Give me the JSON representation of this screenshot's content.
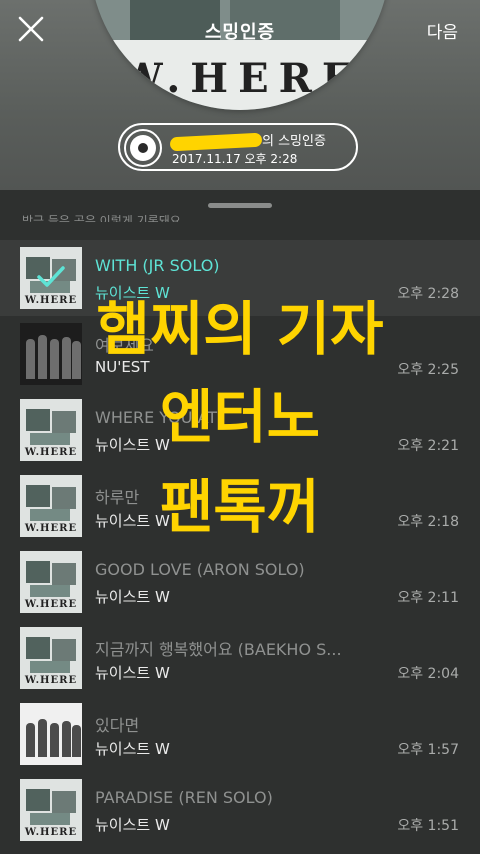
{
  "header": {
    "cover_title": "스밍인증",
    "cover_logo_text": "W.HERE",
    "next_label": "다음",
    "pill_suffix": "의 스밍인증",
    "pill_date": "2017.11.17 오후 2:28"
  },
  "list": {
    "hint": "방금 들은 곡은 이렇게 기록돼요"
  },
  "songs": [
    {
      "title": "WITH (JR SOLO)",
      "artist": "뉴이스트 W",
      "time": "오후 2:28",
      "selected": true
    },
    {
      "title": "여보세요",
      "artist": "NU'EST",
      "time": "오후 2:25"
    },
    {
      "title": "WHERE YOU AT",
      "artist": "뉴이스트 W",
      "time": "오후 2:21"
    },
    {
      "title": "하루만",
      "artist": "뉴이스트 W",
      "time": "오후 2:18"
    },
    {
      "title": "GOOD LOVE (ARON SOLO)",
      "artist": "뉴이스트 W",
      "time": "오후 2:11"
    },
    {
      "title": "지금까지 행복했어요 (BAEKHO S...",
      "artist": "뉴이스트 W",
      "time": "오후 2:04"
    },
    {
      "title": "있다면",
      "artist": "뉴이스트 W",
      "time": "오후 1:57"
    },
    {
      "title": "PARADISE (REN SOLO)",
      "artist": "뉴이스트 W",
      "time": "오후 1:51"
    }
  ],
  "overlay": {
    "line1": "햄찌의 기자",
    "line2": "엔터노",
    "line3": "팬톡꺼"
  },
  "colors": {
    "accent": "#5ee3d5",
    "overlay_text": "#ffd400",
    "background": "#2e302f"
  }
}
